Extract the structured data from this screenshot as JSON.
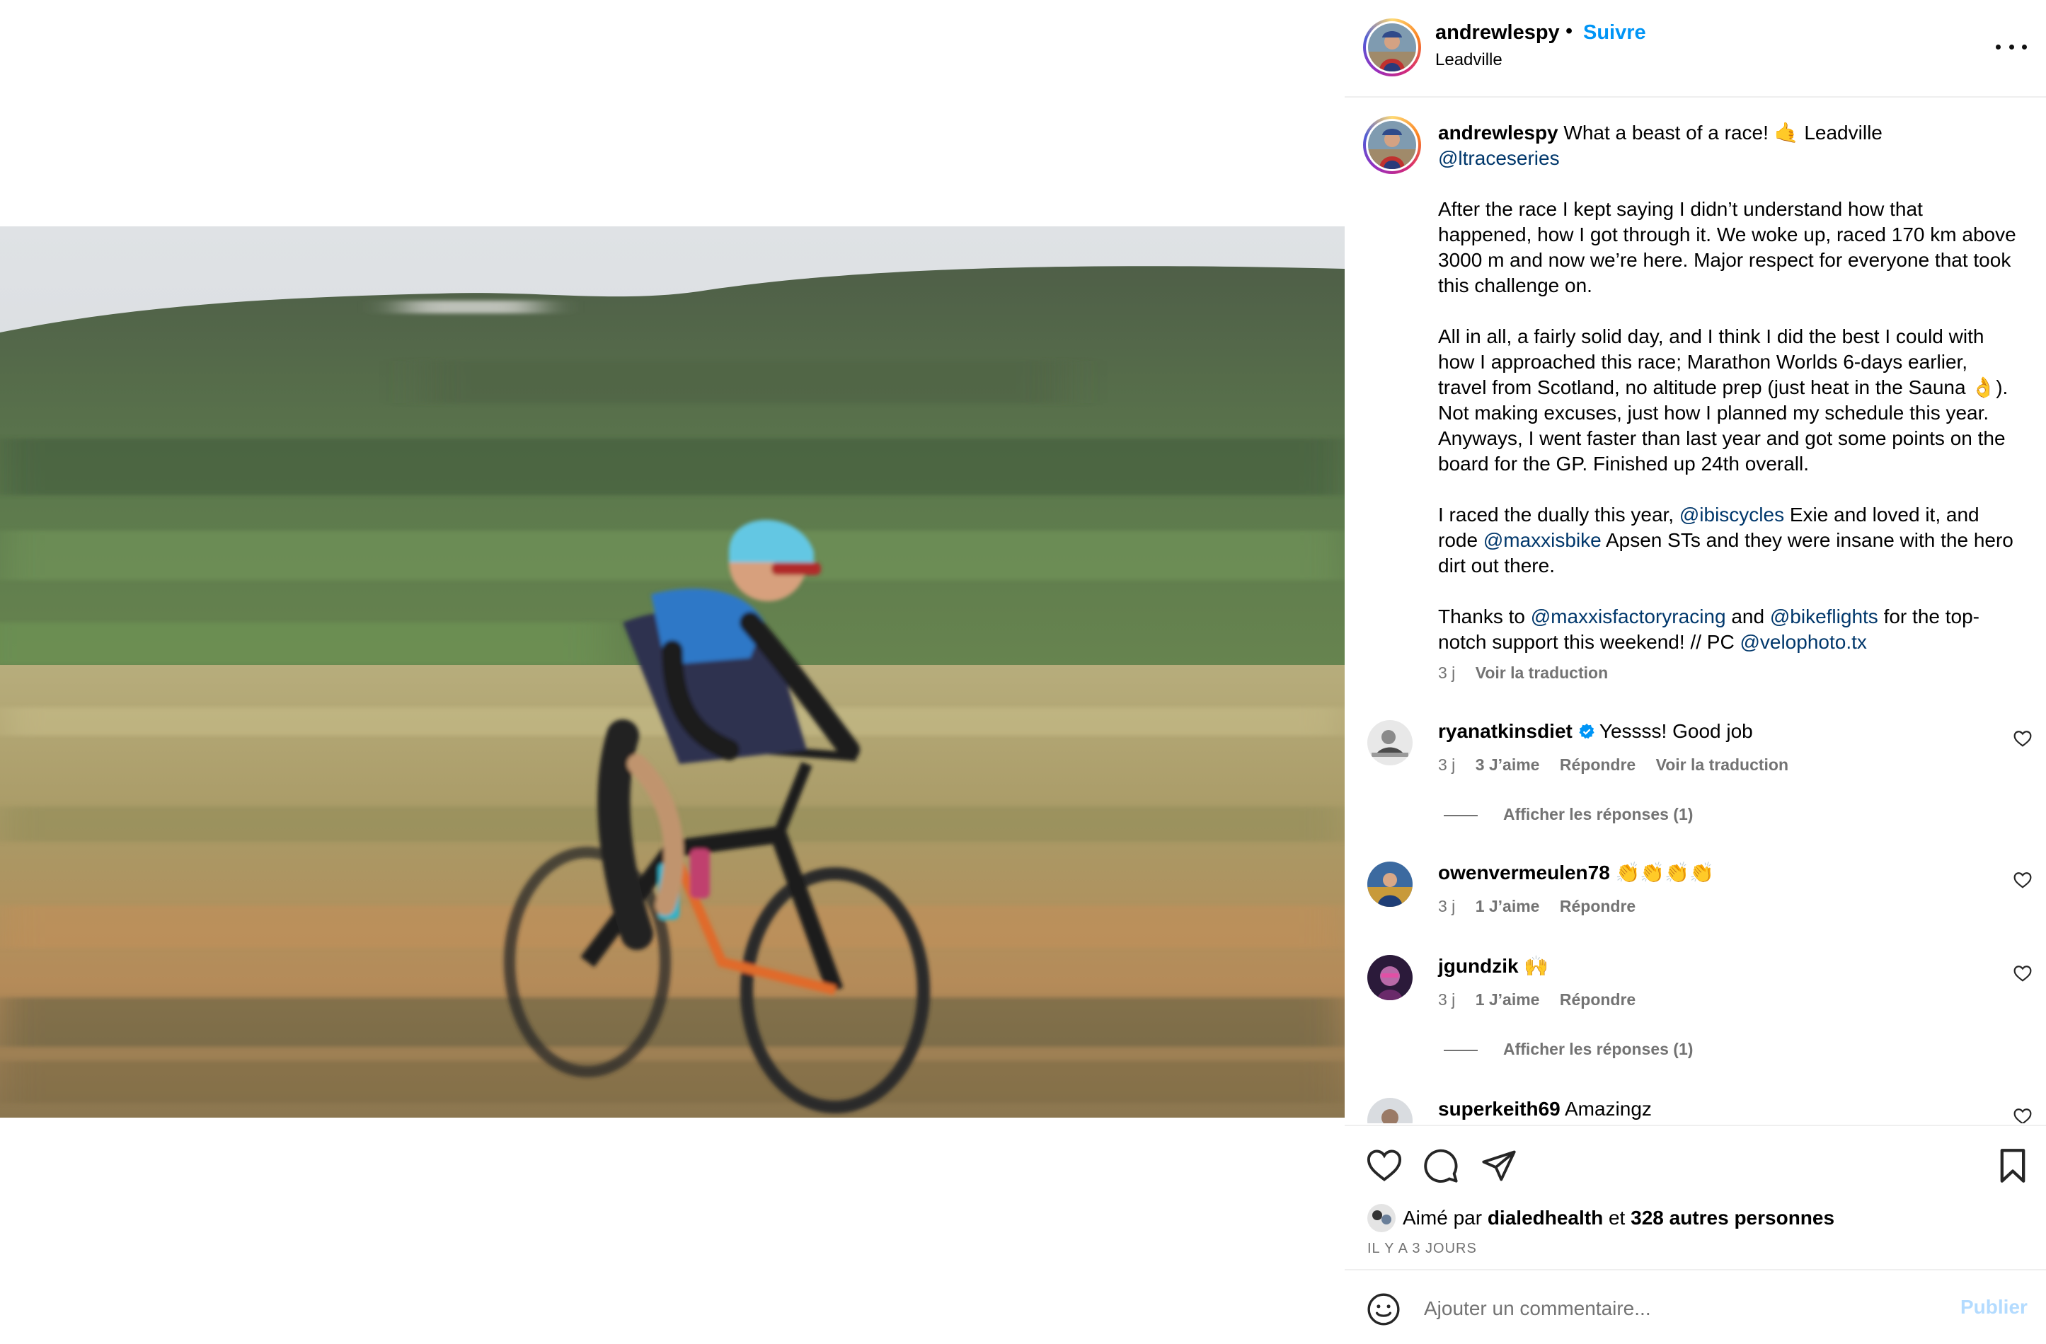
{
  "header": {
    "username": "andrewlespy",
    "dot": "•",
    "follow": "Suivre",
    "location": "Leadville",
    "more_icon": "more-horizontal-icon"
  },
  "caption": {
    "username": "andrewlespy",
    "line1": "What a beast of a race! 🤙 Leadville",
    "mention_ltrace": "@ltraceseries",
    "para1": "After the race I kept saying I didn’t understand how that happened, how I got through it. We woke up, raced 170 km above 3000 m and now we’re here. Major respect for everyone that took this challenge on.",
    "para2": "All in all, a fairly solid day, and I think I did the best I could with how I approached this race; Marathon Worlds 6-days earlier, travel from Scotland, no altitude prep (just heat in the Sauna 👌). Not making excuses, just how I planned my schedule this year. Anyways, I went faster than last year and got some points on the board for the GP. Finished up 24th overall.",
    "para3_a": "I raced the dually this year,",
    "mention_ibis": "@ibiscycles",
    "para3_b": "Exie and loved it, and rode",
    "mention_maxxis": "@maxxisbike",
    "para3_c": "Apsen STs and they were insane with the hero dirt out there.",
    "para4_a": "Thanks to",
    "mention_maxxisfactory": "@maxxisfactoryracing",
    "para4_b": "and",
    "mention_bikeflights": "@bikeflights",
    "para4_c": "for the top-notch support this weekend! // PC",
    "mention_velophoto": "@velophoto.tx",
    "time": "3 j",
    "translate": "Voir la traduction"
  },
  "comments": [
    {
      "username": "ryanatkinsdiet",
      "text": "Yessss! Good job",
      "time": "3 j",
      "likes": "3 J’aime",
      "reply": "Répondre",
      "translate": "Voir la traduction",
      "replies": "Afficher les réponses (1)"
    },
    {
      "username": "owenvermeulen78",
      "text": "👏👏👏👏",
      "time": "3 j",
      "likes": "1 J’aime",
      "reply": "Répondre"
    },
    {
      "username": "jgundzik",
      "text": "🙌",
      "time": "3 j",
      "likes": "1 J’aime",
      "reply": "Répondre",
      "replies": "Afficher les réponses (1)"
    },
    {
      "username": "superkeith69",
      "text": "Amazingz"
    }
  ],
  "actions": {
    "liked_by": "Aimé par",
    "liked_user": "dialedhealth",
    "and": "et",
    "others": "328 autres personnes",
    "time": "IL Y A 3 JOURS"
  },
  "add_comment": {
    "placeholder": "Ajouter un commentaire...",
    "publish": "Publier"
  },
  "colors": {
    "link_blue": "#0095f6",
    "mention": "#00376b",
    "muted": "#737373",
    "publish_disabled": "#b3dbff",
    "verified": "#0095f6"
  }
}
